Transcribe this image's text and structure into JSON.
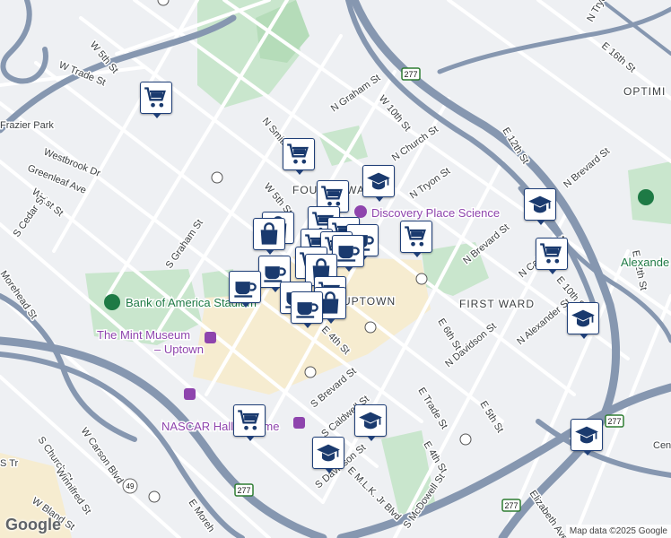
{
  "map": {
    "attribution": "Map data ©2025 Google",
    "logo": "Google"
  },
  "streets": {
    "w_5th_st": "W 5th St",
    "w_trade_st": "W Trade St",
    "frazier_park": "Frazier Park",
    "westbrook_dr": "Westbrook Dr",
    "greenleaf_ave": "Greenleaf Ave",
    "w_1st_st": "W 1st St",
    "s_cedar_st": "S Cedar St",
    "morehead_st": "Morehead St",
    "n_graham_st": "N Graham St",
    "n_smith_st": "N Smith St",
    "w_10th_st": "W 10th St",
    "n_church_st": "N Church St",
    "n_tryon_st": "N Tryon St",
    "w_5th_st_2": "W 5th St",
    "s_graham_st": "S Graham St",
    "e_12th_st": "E 12th St",
    "e_16th_st": "E 16th St",
    "n_tryon_st_top": "N Tryon St",
    "n_brevard_st": "N Brevard St",
    "n_brevard_st_2": "N Brevard St",
    "n_caldwell_st": "N Caldwell St",
    "e_10th_st": "E 10th St",
    "e_12th_st_2": "E 12th St",
    "n_alexander_st": "N Alexander St",
    "e_6th_st": "E 6th St",
    "n_davidson_st": "N Davidson St",
    "e_4th_st": "E 4th St",
    "s_brevard_st": "S Brevard St",
    "e_trade_st": "E Trade St",
    "e_5th_st": "E 5th St",
    "e_4th_st_2": "E 4th St",
    "s_caldwell_st": "S Caldwell St",
    "s_davidson_st": "S Davidson St",
    "e_mlk_jr_blvd": "E M.L.K. Jr Blvd",
    "s_church_st": "S Church St",
    "w_carson_blvd": "W Carson Blvd",
    "winnifred_st": "Winnifred St",
    "w_bland_st": "W Bland St",
    "e_morehead": "E Moreh",
    "s_mcdowell": "S McDowell St",
    "elizabeth_ave": "Elizabeth Ave",
    "cen": "Cen",
    "optimist": "OPTIMI",
    "s_tryon_st": "S Tr",
    "hwy_277a": "277",
    "hwy_277b": "277",
    "hwy_277c": "277",
    "hwy_277d": "277",
    "hwy_49": "49"
  },
  "areas": {
    "fourth_ward": "FOURTH WARD",
    "first_ward": "FIRST WARD",
    "uptown": "UPTOWN"
  },
  "pois": {
    "discovery_place": "Discovery Place Science",
    "bank_of_america_stadium": "Bank of America Stadium",
    "mint_museum_line1": "The Mint Museum",
    "mint_museum_line2": "– Uptown",
    "nascar_hall": "NASCAR Hall of Fame",
    "alexander": "Alexande"
  },
  "colors": {
    "highway": "#8697b0",
    "road": "#ffffff",
    "park": "#c9e6cd",
    "uptown_tint": "#f6ecd0",
    "marker_border": "#1f3f78",
    "icon": "#1a3a6e"
  },
  "markers": [
    {
      "name": "grocery-store",
      "icon": "shopping-cart"
    },
    {
      "name": "grocery-store",
      "icon": "shopping-cart"
    },
    {
      "name": "school",
      "icon": "graduation-cap"
    },
    {
      "name": "grocery-store",
      "icon": "shopping-cart"
    },
    {
      "name": "clothing-store",
      "icon": "shopping-bag"
    },
    {
      "name": "school",
      "icon": "graduation-cap"
    },
    {
      "name": "grocery-store",
      "icon": "shopping-cart"
    },
    {
      "name": "grocery-store",
      "icon": "shopping-cart"
    },
    {
      "name": "school",
      "icon": "graduation-cap"
    },
    {
      "name": "coffee-shop",
      "icon": "coffee-cup"
    },
    {
      "name": "clothing-store",
      "icon": "shopping-bag"
    },
    {
      "name": "grocery-store",
      "icon": "shopping-cart"
    },
    {
      "name": "coffee-shop",
      "icon": "coffee-cup"
    },
    {
      "name": "school",
      "icon": "graduation-cap"
    },
    {
      "name": "school",
      "icon": "graduation-cap"
    },
    {
      "name": "grocery-store",
      "icon": "shopping-cart"
    }
  ]
}
